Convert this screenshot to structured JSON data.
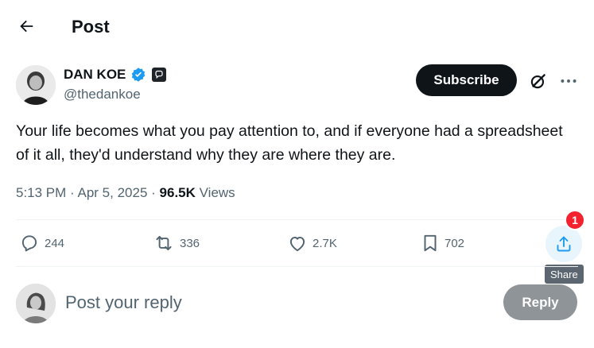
{
  "header": {
    "title": "Post",
    "back_icon": "arrow-left-icon"
  },
  "author": {
    "name": "DAN KOE",
    "handle": "@thedankoe",
    "verified_icon": "verified-badge-icon",
    "affiliate_icon": "chat-badge-icon",
    "avatar_icon": "user-avatar"
  },
  "actions_top": {
    "subscribe_label": "Subscribe",
    "grok_icon": "grok-icon",
    "more_icon": "more-horizontal-icon"
  },
  "post": {
    "text": "Your life becomes what you pay attention to, and if everyone had a spreadsheet of it all, they'd understand why they are where they are.",
    "time": "5:13 PM",
    "date": "Apr 5, 2025",
    "views_count": "96.5K",
    "views_label": "Views"
  },
  "engagement": {
    "replies": "244",
    "reposts": "336",
    "likes": "2.7K",
    "bookmarks": "702",
    "share_badge": "1",
    "share_tooltip": "Share"
  },
  "reply": {
    "placeholder": "Post your reply",
    "button_label": "Reply"
  },
  "colors": {
    "accent": "#1d9bf0",
    "text": "#0f1419",
    "muted": "#536471",
    "badge": "#f4212e"
  }
}
